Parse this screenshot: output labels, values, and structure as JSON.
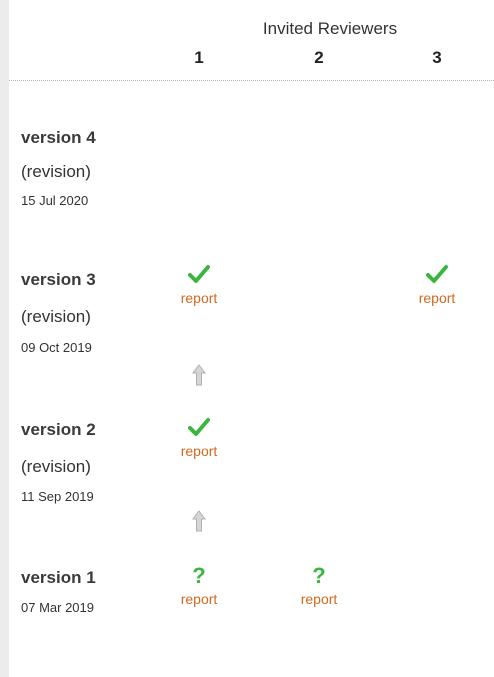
{
  "header": {
    "title": "Invited Reviewers",
    "columns": [
      "1",
      "2",
      "3"
    ]
  },
  "versions": [
    {
      "label": "version 4",
      "type": "(revision)",
      "date": "15 Jul 2020",
      "reviews": []
    },
    {
      "label": "version 3",
      "type": "(revision)",
      "date": "09 Oct 2019",
      "reviews": [
        {
          "reviewer": 1,
          "status": "approved",
          "icon": "check-icon",
          "link": "report"
        },
        {
          "reviewer": 3,
          "status": "approved",
          "icon": "check-icon",
          "link": "report"
        }
      ]
    },
    {
      "label": "version 2",
      "type": "(revision)",
      "date": "11 Sep 2019",
      "reviews": [
        {
          "reviewer": 1,
          "status": "approved",
          "icon": "check-icon",
          "link": "report"
        }
      ]
    },
    {
      "label": "version 1",
      "date": "07 Mar 2019",
      "reviews": [
        {
          "reviewer": 1,
          "status": "pending",
          "icon": "question-mark-icon",
          "link": "report"
        },
        {
          "reviewer": 2,
          "status": "pending",
          "icon": "question-mark-icon",
          "link": "report"
        }
      ]
    }
  ],
  "colors": {
    "check": "#3cb540",
    "question": "#3cb540",
    "report_link": "#d2691e",
    "arrow": "#c8c8c8"
  }
}
